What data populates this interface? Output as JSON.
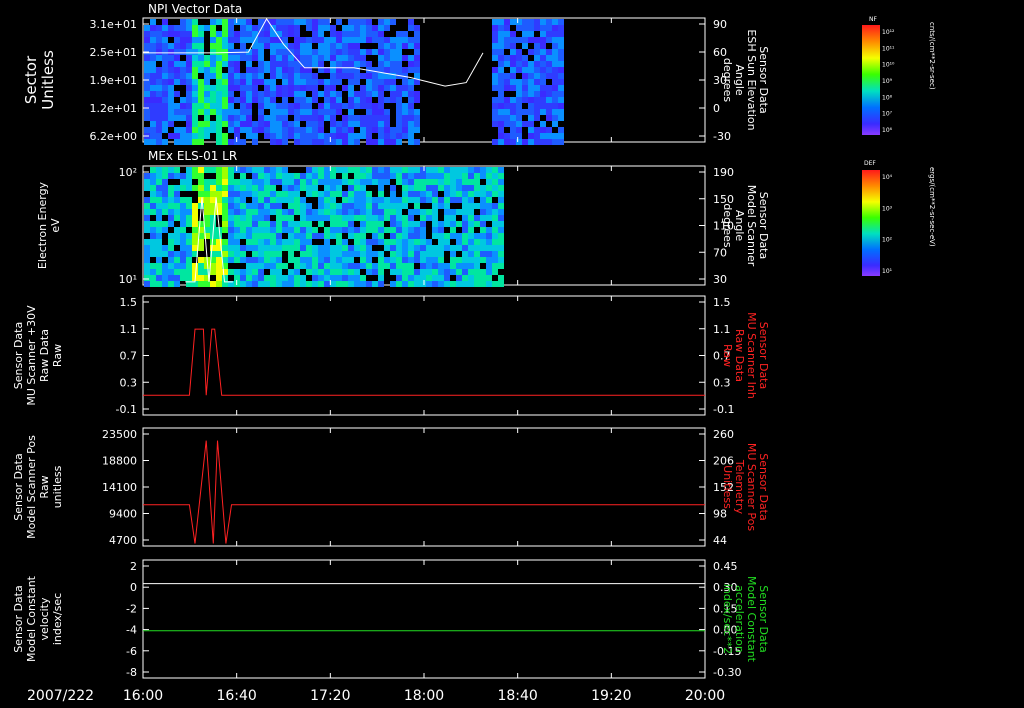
{
  "date_label": "2007/222",
  "time_ticks": [
    "16:00",
    "16:40",
    "17:20",
    "18:00",
    "18:40",
    "19:20",
    "20:00"
  ],
  "chart_data": [
    {
      "type": "heatmap",
      "title": "NPI Vector Data",
      "ylabel": "Sector\nUnitless",
      "yticks": [
        "3.1e+01",
        "2.5e+01",
        "1.9e+01",
        "1.2e+01",
        "6.2e+00"
      ],
      "right_ylabel": "Sensor Data\nESH Sun Elevation\nAngle\ndegrees",
      "right_yticks": [
        "90",
        "60",
        "30",
        "0",
        "-30"
      ],
      "right_ylim": [
        -52,
        90
      ],
      "colorbar": {
        "label": "NF",
        "units": "cnts/(cm**2-sr-sec)",
        "ticks": [
          "10¹²",
          "10¹¹",
          "10¹⁰",
          "10⁹",
          "10⁸",
          "10⁷",
          "10⁶"
        ]
      },
      "series": [
        {
          "x": [
            16.0,
            16.5,
            16.75,
            16.88,
            17.0,
            17.15,
            17.5,
            17.9,
            18.15,
            18.3,
            18.42
          ],
          "values": [
            50,
            50,
            51,
            89,
            60,
            33,
            33,
            22,
            12,
            16,
            50
          ]
        }
      ],
      "black_gaps_hours": [
        [
          17.93,
          18.45
        ]
      ],
      "color": "#ffffff"
    },
    {
      "type": "heatmap",
      "title": "MEx ELS-01 LR",
      "ylabel": "Electron Energy\neV",
      "yticks": [
        "10²",
        "10¹"
      ],
      "right_ylabel": "Sensor Data\nModel Scanner\nAngle\ndegrees",
      "right_yticks": [
        "190",
        "150",
        "110",
        "70",
        "30"
      ],
      "right_ylim": [
        0,
        190
      ],
      "colorbar": {
        "label": "DEF",
        "units": "ergs/(cm**2-sr-sec-eV)",
        "ticks": [
          "10⁴",
          "10³",
          "10²",
          "10¹"
        ]
      },
      "data_end_hours": 18.57,
      "series": [
        {
          "x": [
            16.3,
            16.37,
            16.42,
            16.47,
            16.52,
            16.58,
            16.64
          ],
          "values": [
            5,
            5,
            140,
            5,
            140,
            5,
            5
          ]
        }
      ],
      "color": "#ffffff"
    },
    {
      "type": "line",
      "ylabel": "Sensor Data\nMU Scanner +30V\nRaw Data\nRaw",
      "yticks": [
        "1.5",
        "1.1",
        "0.7",
        "0.3",
        "-0.1"
      ],
      "ylim": [
        -0.3,
        1.5
      ],
      "right_ylabel": "Sensor Data\nMU Scanner Inh\nRaw Data\nRaw",
      "right_yticks": [
        "1.5",
        "1.1",
        "0.7",
        "0.3",
        "-0.1"
      ],
      "series": [
        {
          "x": [
            16.0,
            16.33,
            16.37,
            16.43,
            16.45,
            16.49,
            16.51,
            16.56,
            16.6,
            20.0
          ],
          "values": [
            0.0,
            0.0,
            1.0,
            1.0,
            0.0,
            1.0,
            1.0,
            0.0,
            0.0,
            0.0
          ]
        }
      ],
      "color": "#ff2222"
    },
    {
      "type": "line",
      "ylabel": "Sensor Data\nModel Scanner Pos\nRaw\nunitless",
      "yticks": [
        "23500",
        "18800",
        "14100",
        "9400",
        "4700"
      ],
      "ylim": [
        0,
        23500
      ],
      "right_ylabel": "Sensor Data\nMU Scanner Pos\nTelemetry\nUnitless",
      "right_yticks": [
        "260",
        "206",
        "152",
        "98",
        "44"
      ],
      "series": [
        {
          "x": [
            16.0,
            16.33,
            16.37,
            16.45,
            16.5,
            16.53,
            16.59,
            16.63,
            20.0
          ],
          "values": [
            8200,
            8200,
            500,
            21000,
            500,
            21000,
            500,
            8200,
            8200
          ]
        }
      ],
      "color": "#ff2222"
    },
    {
      "type": "line",
      "ylabel": "Sensor Data\nModel Constant\nvelocity\nindex/sec",
      "yticks": [
        "2",
        "0",
        "-2",
        "-4",
        "-6",
        "-8"
      ],
      "ylim": [
        -8,
        2
      ],
      "right_ylabel": "Sensor Data\nModel Constant\nacceleration\nindex/sec**2",
      "right_yticks": [
        "0.45",
        "0.30",
        "0.15",
        "0.00",
        "-0.15",
        "-0.30"
      ],
      "series": [
        {
          "name": "velocity",
          "x": [
            16.0,
            20.0
          ],
          "values": [
            0,
            0
          ],
          "color": "#ffffff"
        },
        {
          "name": "acceleration",
          "x": [
            16.0,
            20.0
          ],
          "values": [
            -4,
            -4
          ],
          "color": "#22dd22"
        }
      ]
    }
  ]
}
